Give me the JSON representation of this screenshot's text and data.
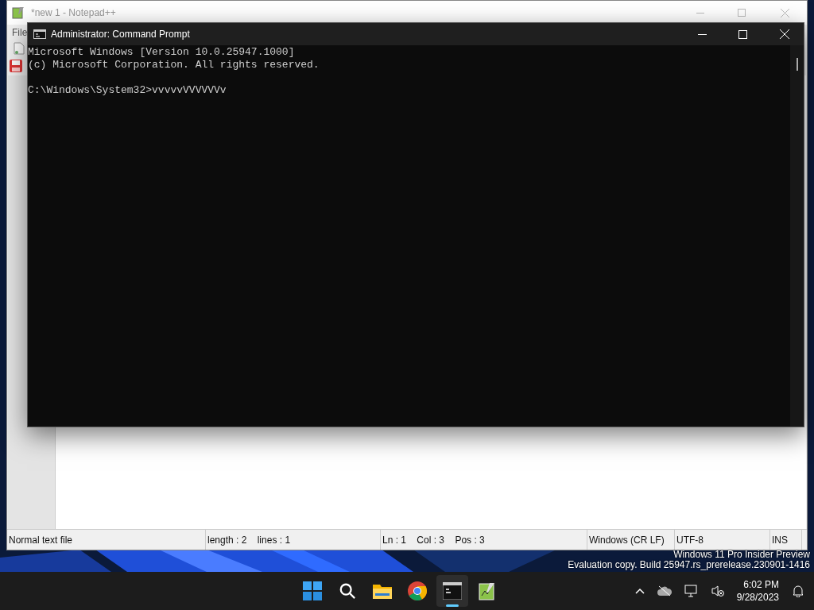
{
  "notepad": {
    "title": "*new 1 - Notepad++",
    "menu": [
      "File"
    ],
    "status_bar": [
      "Normal text file",
      "length : 2    lines : 1",
      "Ln : 1    Col : 3    Pos : 3",
      "Windows (CR LF)",
      "UTF-8",
      "INS"
    ]
  },
  "cmd": {
    "title": "Administrator: Command Prompt",
    "blocks": [
      [
        "Microsoft Windows [Version 10.0.25947.1000]",
        "(c) Microsoft Corporation. All rights reserved."
      ],
      [
        "C:\\Windows\\System32>vvvvvVVVVVVv"
      ]
    ]
  },
  "watermark": [
    "Windows 11 Pro Insider Preview",
    "Evaluation copy. Build 25947.rs_prerelease.230901-1416"
  ],
  "taskbar": {
    "apps": [
      {
        "kind": "start",
        "selected": false
      },
      {
        "kind": "search",
        "selected": false
      },
      {
        "kind": "explorer",
        "selected": false
      },
      {
        "kind": "chrome",
        "selected": false
      },
      {
        "kind": "terminal",
        "selected": true
      },
      {
        "kind": "notepad",
        "selected": false
      }
    ],
    "time": "6:02 PM",
    "date": "9/28/2023"
  }
}
